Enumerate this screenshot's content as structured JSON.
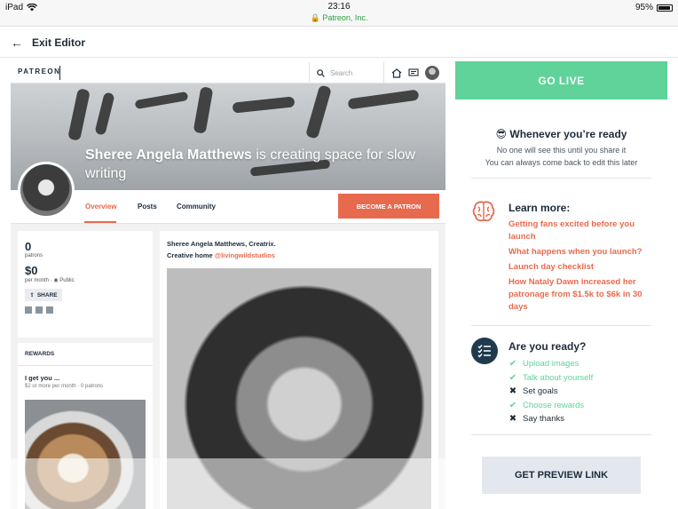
{
  "status_bar": {
    "device": "iPad",
    "time": "23:16",
    "url": "Patreon, Inc.",
    "battery": "95%"
  },
  "topnav": {
    "exit_label": "Exit Editor"
  },
  "preview": {
    "logo": "PATREON",
    "search_placeholder": "Search",
    "banner_name": "Sheree Angela Matthews",
    "banner_rest": " is creating space for slow writing",
    "tabs": [
      "Overview",
      "Posts",
      "Community"
    ],
    "become_patron": "BECOME A PATRON",
    "stats": {
      "patrons_count": "0",
      "patrons_label": "patrons",
      "amount": "$0",
      "amount_label": "per month",
      "visibility": "Public",
      "share": "SHARE"
    },
    "rewards": {
      "title": "REWARDS",
      "reward_name": "I get you ...",
      "reward_meta": "$2 or more per month · 0 patrons"
    },
    "post": {
      "title_line1": "Sheree Angela Matthews, Creatrix.",
      "title_line2_prefix": "Creative home ",
      "title_line2_link": "@livingwildstudios"
    }
  },
  "panel": {
    "go_live": "GO LIVE",
    "ready_emoji": "😎",
    "ready_title": "Whenever you’re ready",
    "ready_sub1": "No one will see this until you share it",
    "ready_sub2": "You can always come back to edit this later",
    "learn_title": "Learn more:",
    "learn_links": [
      "Getting fans excited before you launch",
      "What happens when you launch?",
      "Launch day checklist",
      "How Nataly Dawn increased her patronage from $1.5k to $6k in 30 days"
    ],
    "check_title": "Are you ready?",
    "checklist": [
      {
        "label": "Upload images",
        "done": true
      },
      {
        "label": "Talk about yourself",
        "done": true
      },
      {
        "label": "Set goals",
        "done": false
      },
      {
        "label": "Choose rewards",
        "done": true
      },
      {
        "label": "Say thanks",
        "done": false
      }
    ],
    "preview_link": "GET PREVIEW LINK"
  }
}
